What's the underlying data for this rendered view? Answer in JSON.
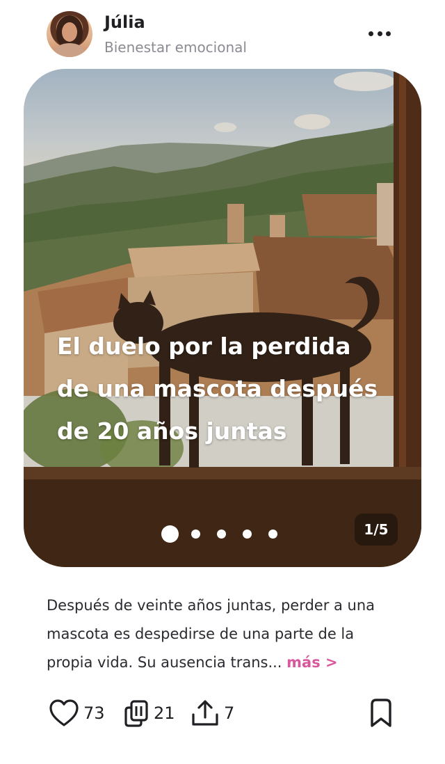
{
  "header": {
    "user_name": "Júlia",
    "user_subtitle": "Bienestar emocional",
    "avatar_icon": "user-avatar-icon",
    "more_icon": "more-horizontal-icon"
  },
  "hero": {
    "title": "El duelo por la perdida de una mascota después de 20 años juntas",
    "counter": "1/5",
    "slides_total": 5,
    "current_slide": 1
  },
  "post": {
    "text": "Después de veinte años juntas, perder a una mascota es despedirse de una parte de la propia vida. Su ausencia trans...",
    "more_label": "más >"
  },
  "actions": {
    "likes": "73",
    "comments": "21",
    "shares": "7",
    "like_icon": "heart-icon",
    "comments_icon": "copy-stack-icon",
    "share_icon": "share-upload-icon",
    "bookmark_icon": "bookmark-icon"
  },
  "colors": {
    "accent": "#d9579c",
    "text": "#1f1f24",
    "muted": "#8b8b93"
  }
}
